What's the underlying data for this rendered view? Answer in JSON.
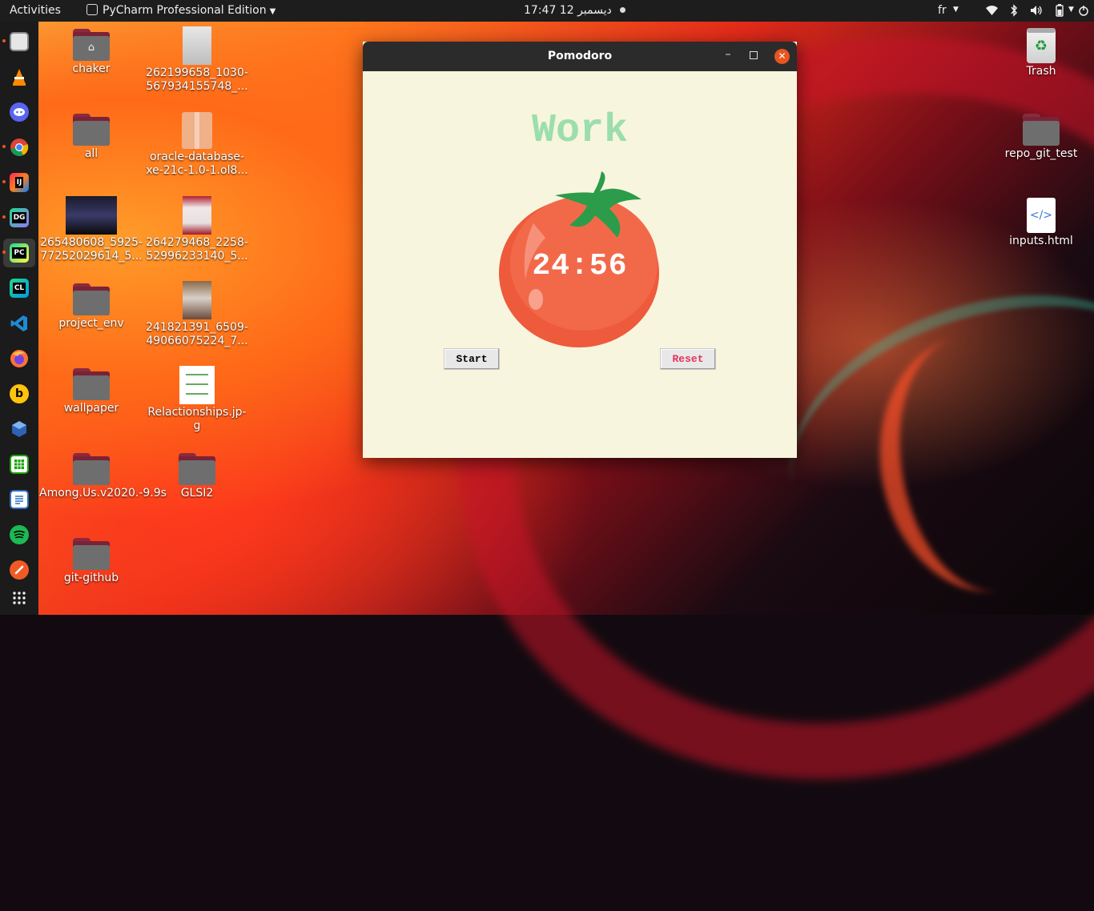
{
  "topbar": {
    "activities": "Activities",
    "app_name": "PyCharm Professional Edition",
    "clock": "17:47  12 ديسمبر",
    "language": "fr"
  },
  "dock": {
    "items": [
      "files",
      "vlc",
      "discord",
      "chrome",
      "intellij",
      "datagrip",
      "pycharm",
      "clion",
      "vscode",
      "firefox",
      "bitwarden",
      "virtualbox",
      "libreoffice-calc",
      "libreoffice-writer",
      "spotify",
      "postman",
      "show-applications"
    ],
    "labels": {
      "intellij": "IJ",
      "datagrip": "DG",
      "pycharm": "PC",
      "clion": "CL"
    }
  },
  "desktop": {
    "chaker": "chaker",
    "img1": "262199658_1030-567934155748_...",
    "all": "all",
    "oracle": "oracle-database-xe-21c-1.0-1.ol8...",
    "img2": "265480608_5925-77252029614_5...",
    "img3": "264279468_2258-52996233140_5...",
    "project_env": "project_env",
    "img4": "241821391_6509-49066075224_7...",
    "wallpaper": "wallpaper",
    "relationships": "Relactionships.jp-g",
    "among_us": "Among.Us.v2020.-9.9s",
    "glsi2": "GLSI2",
    "git_github": "git-github",
    "trash": "Trash",
    "repo_git_test": "repo_git_test",
    "inputs_html": "inputs.html"
  },
  "window": {
    "title": "Pomodoro",
    "mode_label": "Work",
    "timer": "24:56",
    "start_label": "Start",
    "reset_label": "Reset"
  },
  "colors": {
    "window_bg": "#f7f5dd",
    "mode_label": "#9bdeac",
    "reset_text": "#e7305b",
    "ubuntu_orange": "#e95420"
  }
}
